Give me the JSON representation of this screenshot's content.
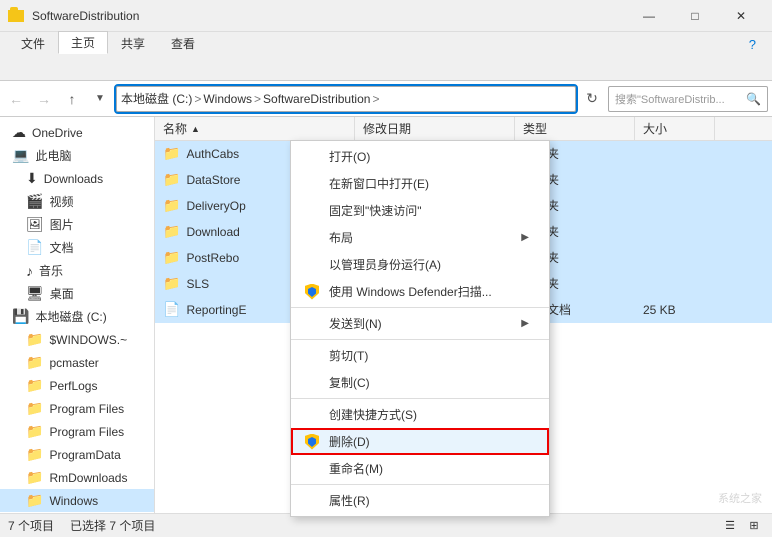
{
  "titlebar": {
    "title": "SoftwareDistribution",
    "min_label": "—",
    "max_label": "□",
    "close_label": "✕"
  },
  "ribbon": {
    "tabs": [
      "文件",
      "主页",
      "共享",
      "查看"
    ],
    "active_tab": "主页",
    "help_icon": "?"
  },
  "addressbar": {
    "path_parts": [
      "本地磁盘 (C:)",
      "Windows",
      "SoftwareDistribution"
    ],
    "search_placeholder": "搜索\"SoftwareDistrib...",
    "search_icon": "🔍"
  },
  "sidebar": {
    "items": [
      {
        "label": "OneDrive",
        "icon": "☁",
        "indent": 0
      },
      {
        "label": "此电脑",
        "icon": "💻",
        "indent": 0
      },
      {
        "label": "Downloads",
        "icon": "⬇",
        "indent": 1
      },
      {
        "label": "视频",
        "icon": "🎬",
        "indent": 1
      },
      {
        "label": "图片",
        "icon": "🖼",
        "indent": 1
      },
      {
        "label": "文档",
        "icon": "📄",
        "indent": 1
      },
      {
        "label": "音乐",
        "icon": "♪",
        "indent": 1
      },
      {
        "label": "桌面",
        "icon": "🖥",
        "indent": 1
      },
      {
        "label": "本地磁盘 (C:)",
        "icon": "💾",
        "indent": 0
      },
      {
        "label": "$WINDOWS.~",
        "icon": "📁",
        "indent": 1
      },
      {
        "label": "pcmaster",
        "icon": "📁",
        "indent": 1
      },
      {
        "label": "PerfLogs",
        "icon": "📁",
        "indent": 1
      },
      {
        "label": "Program Files",
        "icon": "📁",
        "indent": 1
      },
      {
        "label": "Program Files",
        "icon": "📁",
        "indent": 1
      },
      {
        "label": "ProgramData",
        "icon": "📁",
        "indent": 1
      },
      {
        "label": "RmDownloads",
        "icon": "📁",
        "indent": 1
      },
      {
        "label": "Windows",
        "icon": "📁",
        "indent": 1,
        "selected": true
      }
    ]
  },
  "columns": [
    {
      "label": "名称",
      "key": "name"
    },
    {
      "label": "修改日期",
      "key": "date"
    },
    {
      "label": "类型",
      "key": "type"
    },
    {
      "label": "大小",
      "key": "size"
    }
  ],
  "files": [
    {
      "name": "AuthCabs",
      "date": "",
      "type": "文件夹",
      "icon": "folder",
      "selected": true
    },
    {
      "name": "DataStore",
      "date": "",
      "type": "文件夹",
      "icon": "folder",
      "selected": true
    },
    {
      "name": "DeliveryOp",
      "date": "",
      "type": "文件夹",
      "icon": "folder",
      "selected": true
    },
    {
      "name": "Download",
      "date": "",
      "type": "文件夹",
      "icon": "folder",
      "selected": true
    },
    {
      "name": "PostRebo",
      "date": "",
      "type": "文件夹",
      "icon": "folder",
      "selected": true
    },
    {
      "name": "SLS",
      "date": "",
      "type": "文件夹",
      "icon": "folder",
      "selected": true
    },
    {
      "name": "ReportingE",
      "date": "",
      "type": "文本文档",
      "icon": "doc",
      "selected": true,
      "size": "25 KB"
    }
  ],
  "context_menu": {
    "items": [
      {
        "label": "打开(O)",
        "icon": "",
        "has_arrow": false,
        "type": "item"
      },
      {
        "label": "在新窗口中打开(E)",
        "icon": "",
        "has_arrow": false,
        "type": "item"
      },
      {
        "label": "固定到\"快速访问\"",
        "icon": "",
        "has_arrow": false,
        "type": "item"
      },
      {
        "label": "布局",
        "icon": "",
        "has_arrow": true,
        "type": "item"
      },
      {
        "label": "以管理员身份运行(A)",
        "icon": "",
        "has_arrow": false,
        "type": "item"
      },
      {
        "label": "使用 Windows Defender扫描...",
        "icon": "defender",
        "has_arrow": false,
        "type": "item"
      },
      {
        "label": "",
        "type": "divider"
      },
      {
        "label": "发送到(N)",
        "icon": "",
        "has_arrow": true,
        "type": "item"
      },
      {
        "label": "",
        "type": "divider"
      },
      {
        "label": "剪切(T)",
        "icon": "",
        "has_arrow": false,
        "type": "item"
      },
      {
        "label": "复制(C)",
        "icon": "",
        "has_arrow": false,
        "type": "item"
      },
      {
        "label": "",
        "type": "divider"
      },
      {
        "label": "创建快捷方式(S)",
        "icon": "",
        "has_arrow": false,
        "type": "item"
      },
      {
        "label": "删除(D)",
        "icon": "defender",
        "has_arrow": false,
        "type": "item",
        "highlighted": true,
        "delete": true
      },
      {
        "label": "重命名(M)",
        "icon": "",
        "has_arrow": false,
        "type": "item"
      },
      {
        "label": "",
        "type": "divider"
      },
      {
        "label": "属性(R)",
        "icon": "",
        "has_arrow": false,
        "type": "item"
      }
    ]
  },
  "statusbar": {
    "count": "7 个项目",
    "selected": "已选择 7 个项目"
  },
  "watermark": "系统之家"
}
